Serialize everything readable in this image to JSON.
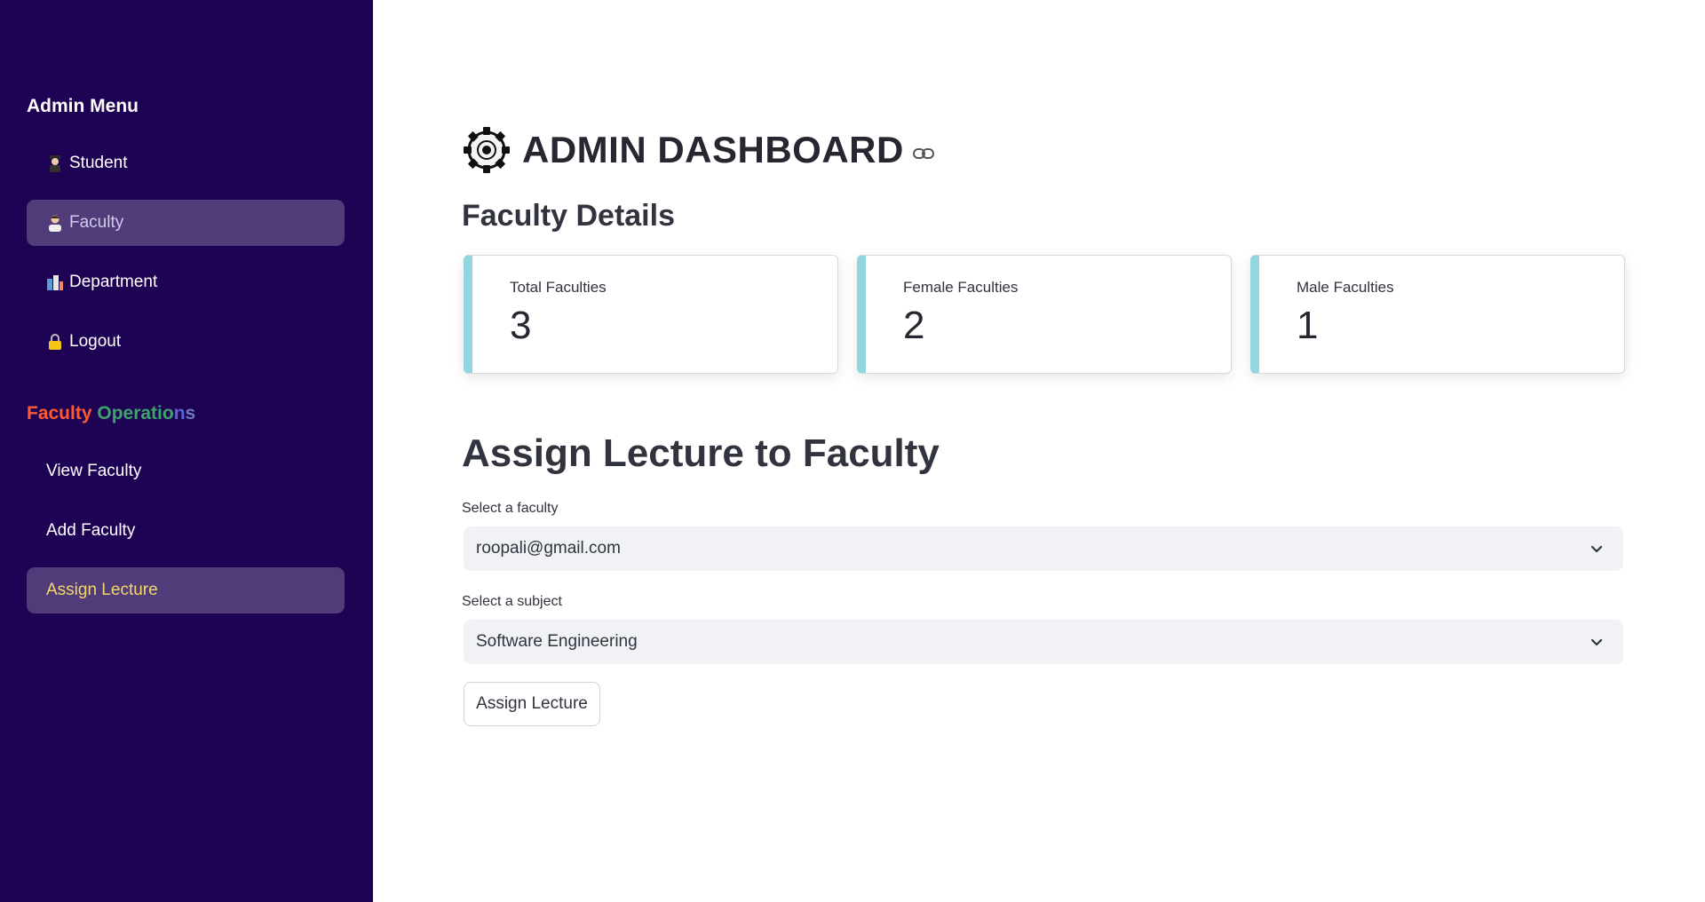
{
  "sidebar": {
    "menu_title": "Admin Menu",
    "items": [
      {
        "label": "Student",
        "icon": "student-icon"
      },
      {
        "label": "Faculty",
        "icon": "faculty-icon",
        "active": true
      },
      {
        "label": "Department",
        "icon": "department-icon"
      },
      {
        "label": "Logout",
        "icon": "lock-icon"
      }
    ],
    "ops_title_parts": [
      "Faculty ",
      "Operatio",
      "n",
      "s"
    ],
    "ops_items": [
      {
        "label": "View Faculty"
      },
      {
        "label": "Add Faculty"
      },
      {
        "label": "Assign Lecture",
        "active": true
      }
    ]
  },
  "main": {
    "title": "ADMIN DASHBOARD",
    "section_title": "Faculty Details",
    "metrics": [
      {
        "label": "Total Faculties",
        "value": "3"
      },
      {
        "label": "Female Faculties",
        "value": "2"
      },
      {
        "label": "Male Faculties",
        "value": "1"
      }
    ],
    "assign_title": "Assign Lecture to Faculty",
    "faculty_select": {
      "label": "Select a faculty",
      "value": "roopali@gmail.com"
    },
    "subject_select": {
      "label": "Select a subject",
      "value": "Software Engineering"
    },
    "assign_button": "Assign Lecture"
  },
  "colors": {
    "sidebar_bg": "#1e0354",
    "active_item_bg": "#4f3c78",
    "metric_accent": "#93d6e0",
    "select_bg": "#f0f2f6"
  }
}
